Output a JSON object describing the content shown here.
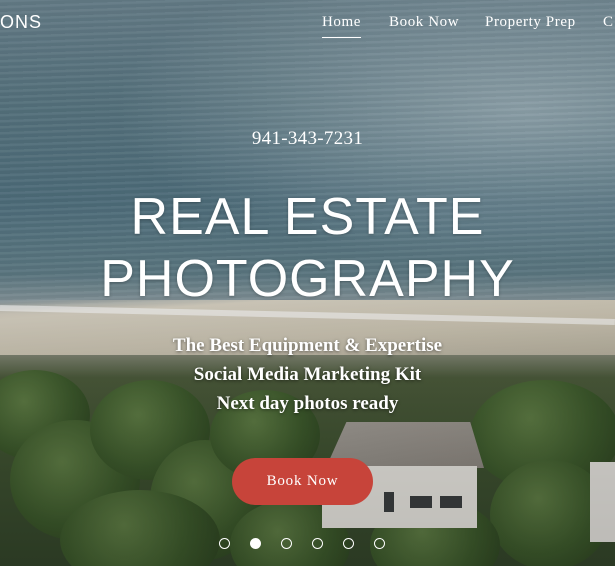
{
  "header": {
    "logo_text": "ONS",
    "nav": [
      {
        "label": "Home",
        "active": true
      },
      {
        "label": "Book Now",
        "active": false
      },
      {
        "label": "Property Prep",
        "active": false
      },
      {
        "label": "C",
        "active": false
      }
    ]
  },
  "hero": {
    "phone": "941-343-7231",
    "headline_line1": "REAL ESTATE",
    "headline_line2": "PHOTOGRAPHY",
    "sub_lines": [
      "The Best Equipment & Expertise",
      "Social Media Marketing Kit",
      "Next day photos ready"
    ],
    "cta_label": "Book Now"
  },
  "slideshow": {
    "slide_count": 6,
    "active_index": 1
  },
  "colors": {
    "accent": "#c7443a",
    "text": "#ffffff"
  }
}
